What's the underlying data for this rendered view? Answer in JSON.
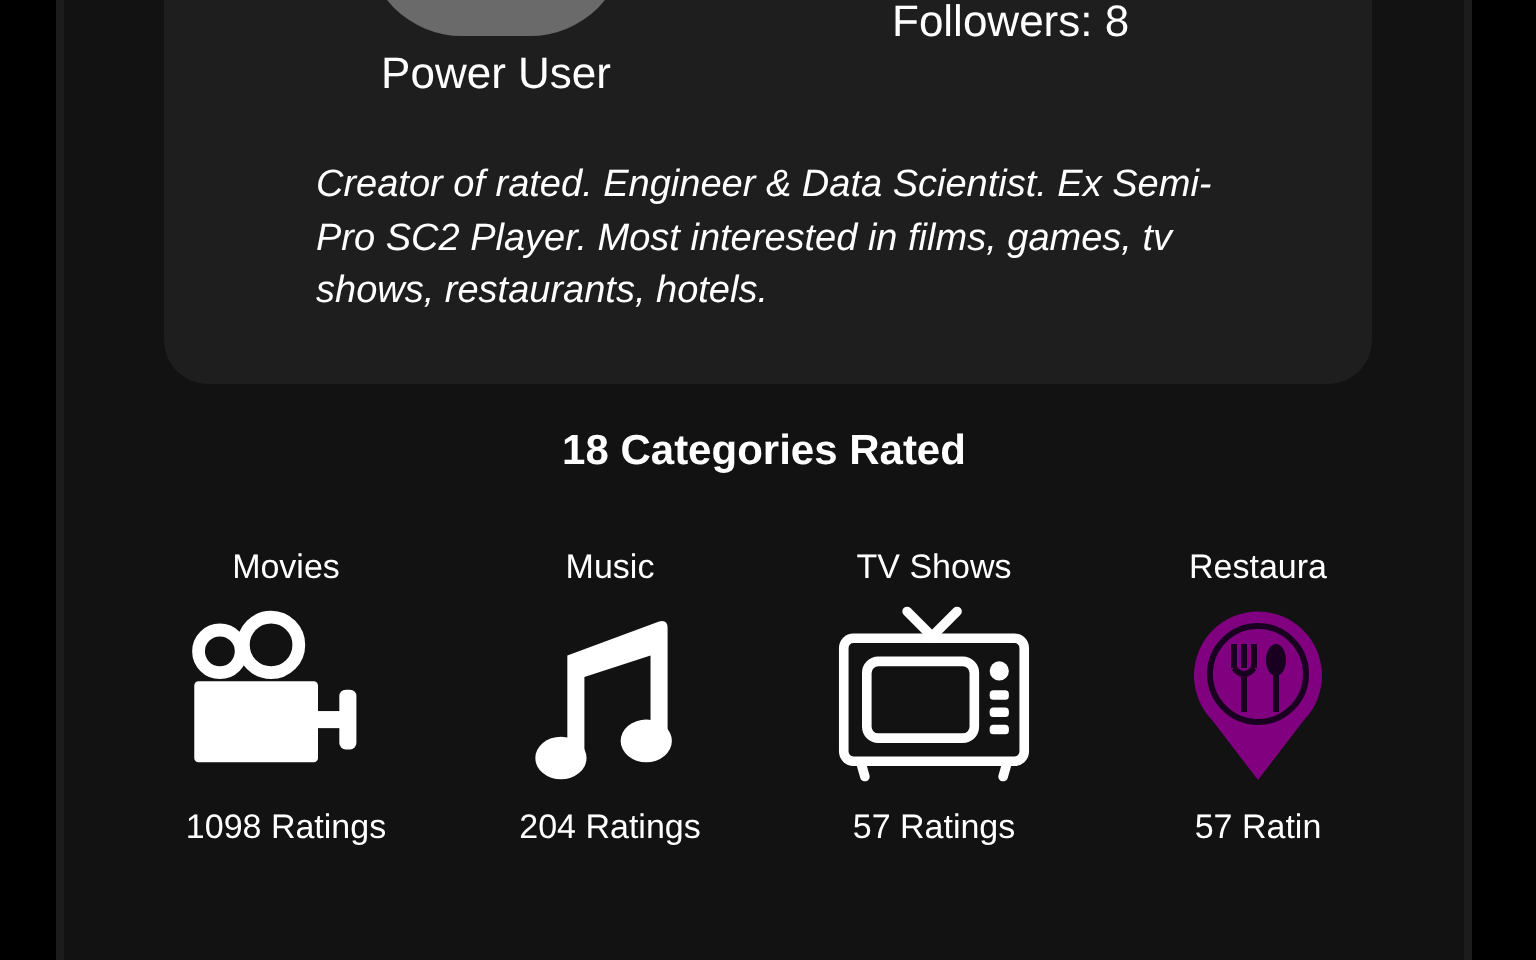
{
  "profile": {
    "role": "Power User",
    "followers": "Followers: 8",
    "bio": "Creator of rated. Engineer & Data Scientist. Ex Semi-Pro SC2 Player. Most interested in films, games, tv shows, restaurants, hotels."
  },
  "categories_title": "18 Categories Rated",
  "categories": [
    {
      "kind": "movies",
      "label": "Movies",
      "count": "1098 Ratings",
      "color": "#ffffff"
    },
    {
      "kind": "music",
      "label": "Music",
      "count": "204 Ratings",
      "color": "#ffffff"
    },
    {
      "kind": "tv",
      "label": "TV Shows",
      "count": "57 Ratings",
      "color": "#ffffff"
    },
    {
      "kind": "restaurant",
      "label": "Restaura",
      "count": "57 Ratin",
      "color": "#800080"
    }
  ]
}
